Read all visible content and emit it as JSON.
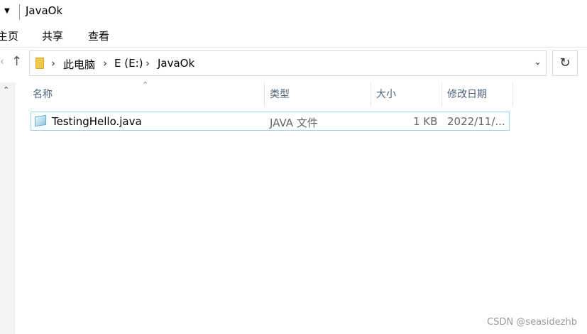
{
  "window": {
    "title": "JavaOk"
  },
  "ribbon": {
    "tabs": [
      "主页",
      "共享",
      "查看"
    ]
  },
  "address": {
    "crumbs": [
      "此电脑",
      "E (E:)",
      "JavaOk"
    ]
  },
  "columns": [
    "名称",
    "类型",
    "大小",
    "修改日期"
  ],
  "files": [
    {
      "name": "TestingHello.java",
      "type": "JAVA 文件",
      "size": "1 KB",
      "modified": "2022/11/..."
    }
  ],
  "watermark": "CSDN @seasidezhb",
  "icons": {
    "qa_menu": "chevron-down-icon",
    "up": "arrow-up-icon",
    "back": "chevron-left-icon",
    "folder": "folder-icon",
    "crumb_sep": "chevron-right-icon",
    "dropdown": "chevron-down-icon",
    "refresh": "refresh-icon",
    "file": "java-file-icon"
  }
}
